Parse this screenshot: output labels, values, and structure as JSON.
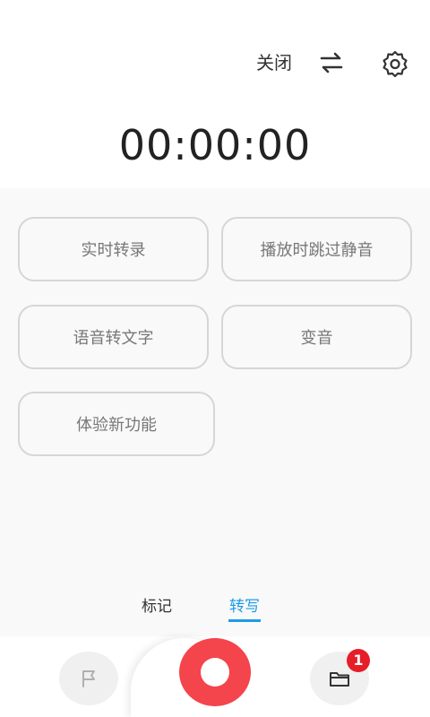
{
  "header": {
    "close_label": "关闭"
  },
  "timer": {
    "value": "00:00:00"
  },
  "features": {
    "realtime_transcribe": "实时转录",
    "skip_silence": "播放时跳过静音",
    "speech_to_text": "语音转文字",
    "voice_change": "变音",
    "try_new_features": "体验新功能"
  },
  "tabs": {
    "mark": "标记",
    "transcribe": "转写",
    "active": "transcribe"
  },
  "bottom": {
    "files_badge": "1"
  },
  "colors": {
    "accent": "#1e9be8",
    "record": "#f4444c",
    "badge": "#e61e28"
  },
  "icons": {
    "swap": "swap-arrows-icon",
    "settings": "gear-icon",
    "mark": "flag-icon",
    "files": "folder-icon"
  }
}
